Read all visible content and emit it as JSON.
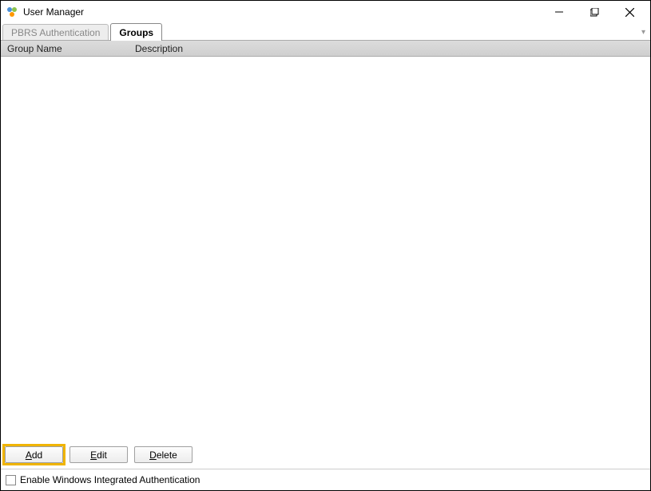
{
  "window": {
    "title": "User Manager"
  },
  "tabs": {
    "pbrs": "PBRS Authentication",
    "groups": "Groups"
  },
  "columns": {
    "group_name": "Group Name",
    "description": "Description"
  },
  "buttons": {
    "add_prefix": "A",
    "add_rest": "dd",
    "edit_prefix": "E",
    "edit_rest": "dit",
    "delete_prefix": "D",
    "delete_rest": "elete"
  },
  "checkbox": {
    "label": "Enable Windows Integrated Authentication"
  }
}
